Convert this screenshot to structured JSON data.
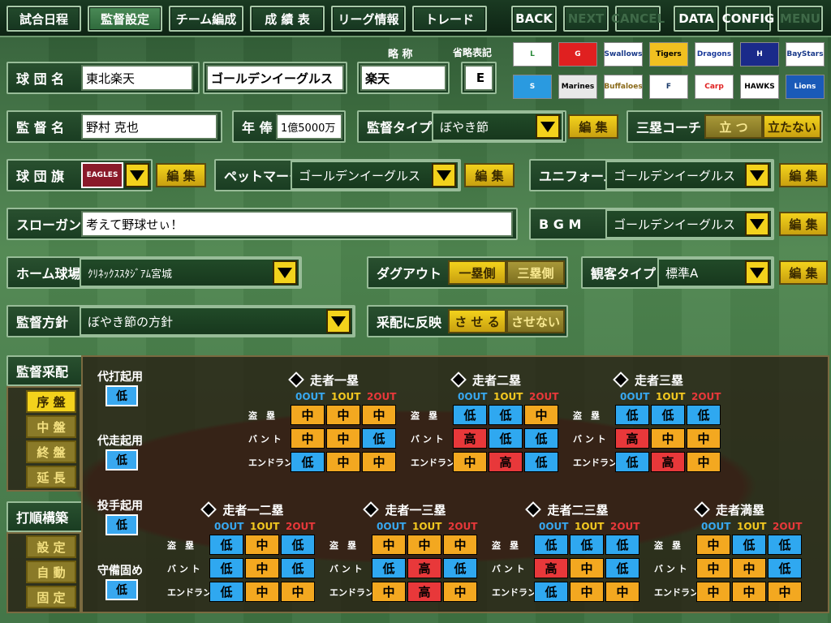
{
  "nav": {
    "items": [
      {
        "label": "試合日程",
        "selected": false
      },
      {
        "label": "監督設定",
        "selected": true
      },
      {
        "label": "チーム編成",
        "selected": false
      },
      {
        "label": "成 績 表",
        "selected": false
      },
      {
        "label": "リーグ情報",
        "selected": false
      },
      {
        "label": "トレード",
        "selected": false
      }
    ],
    "back": "BACK",
    "next": "NEXT",
    "cancel": "CANCEL",
    "data": "DATA",
    "config": "CONFIG",
    "menu": "MENU"
  },
  "team": {
    "name_label": "球 団 名",
    "name": "東北楽天",
    "nickname": "ゴールデンイーグルス",
    "abbr_header": "略 称",
    "abbr": "楽天",
    "short_header": "省略表記",
    "short": "E"
  },
  "logos": [
    {
      "text": "L",
      "bg": "#ffffff",
      "fg": "#2a8a3a"
    },
    {
      "text": "G",
      "bg": "#e02020",
      "fg": "#ffffff"
    },
    {
      "text": "Swallows",
      "bg": "#ffffff",
      "fg": "#1a3a8a"
    },
    {
      "text": "Tigers",
      "bg": "#f0c020",
      "fg": "#000000"
    },
    {
      "text": "Dragons",
      "bg": "#ffffff",
      "fg": "#1a3a9a"
    },
    {
      "text": "H",
      "bg": "#1a2a8a",
      "fg": "#ffffff"
    },
    {
      "text": "BayStars",
      "bg": "#ffffff",
      "fg": "#1a3a8a"
    },
    {
      "text": "S",
      "bg": "#2a9ae0",
      "fg": "#ffffff"
    },
    {
      "text": "Marines",
      "bg": "#e8e8e8",
      "fg": "#000000"
    },
    {
      "text": "Buffaloes",
      "bg": "#ffffff",
      "fg": "#8a6a1a"
    },
    {
      "text": "F",
      "bg": "#ffffff",
      "fg": "#1a3a6a"
    },
    {
      "text": "Carp",
      "bg": "#ffffff",
      "fg": "#e02020"
    },
    {
      "text": "HAWKS",
      "bg": "#ffffff",
      "fg": "#000000"
    },
    {
      "text": "Lions",
      "bg": "#1a5ab8",
      "fg": "#ffffff"
    },
    {
      "text": "EAGLES",
      "bg": "#8a1a2a",
      "fg": "#ffffff"
    }
  ],
  "manager": {
    "label": "監 督 名",
    "name": "野村 克也",
    "salary_label": "年 俸",
    "salary": "1億5000万",
    "type_label": "監督タイプ",
    "type": "ぼやき節",
    "edit": "編 集",
    "coach_label": "三塁コーチ",
    "coach_on": "立 つ",
    "coach_off": "立たない"
  },
  "flag": {
    "label": "球 団 旗",
    "flag_text": "EAGLES",
    "edit": "編 集",
    "pet_label": "ペットマーク",
    "pet": "ゴールデンイーグルス",
    "uniform_label": "ユニフォーム",
    "uniform": "ゴールデンイーグルス"
  },
  "slogan": {
    "label": "スローガン",
    "text": "考えて野球せぃ！",
    "bgm_label": "B G M",
    "bgm": "ゴールデンイーグルス"
  },
  "stadium": {
    "label": "ホーム球場",
    "name": "ｸﾘﾈｯｸｽｽﾀｼﾞｱﾑ宮城",
    "dugout_label": "ダグアウト",
    "dugout_1": "一塁側",
    "dugout_3": "三塁側",
    "crowd_label": "観客タイプ",
    "crowd": "標準A"
  },
  "policy": {
    "label": "監督方針",
    "text": "ぼやき節の方針",
    "reflect_label": "采配に反映",
    "reflect_yes": "さ せ る",
    "reflect_no": "させない"
  },
  "tactics": {
    "label": "監督采配",
    "phases": [
      "序 盤",
      "中 盤",
      "終 盤",
      "延 長"
    ],
    "order_label": "打順構築",
    "order_modes": [
      "設 定",
      "自 動",
      "固 定"
    ],
    "subs": [
      {
        "label": "代打起用",
        "value": "低"
      },
      {
        "label": "代走起用",
        "value": "低"
      },
      {
        "label": "投手起用",
        "value": "低"
      },
      {
        "label": "守備固め",
        "value": "低"
      }
    ],
    "out_headers": [
      "0OUT",
      "1OUT",
      "2OUT"
    ],
    "row_labels": [
      "盗　塁",
      "バ ン ト",
      "エンドラン"
    ],
    "runners": [
      {
        "title": "走者一塁",
        "grid": [
          [
            "中",
            "中",
            "中"
          ],
          [
            "中",
            "中",
            "低"
          ],
          [
            "低",
            "中",
            "中"
          ]
        ]
      },
      {
        "title": "走者二塁",
        "grid": [
          [
            "低",
            "低",
            "中"
          ],
          [
            "高",
            "低",
            "低"
          ],
          [
            "中",
            "高",
            "低"
          ]
        ]
      },
      {
        "title": "走者三塁",
        "grid": [
          [
            "低",
            "低",
            "低"
          ],
          [
            "高",
            "中",
            "中"
          ],
          [
            "低",
            "高",
            "中"
          ]
        ]
      },
      {
        "title": "走者一二塁",
        "grid": [
          [
            "低",
            "中",
            "低"
          ],
          [
            "低",
            "中",
            "低"
          ],
          [
            "低",
            "中",
            "中"
          ]
        ]
      },
      {
        "title": "走者一三塁",
        "grid": [
          [
            "中",
            "中",
            "中"
          ],
          [
            "低",
            "高",
            "低"
          ],
          [
            "中",
            "高",
            "中"
          ]
        ]
      },
      {
        "title": "走者二三塁",
        "grid": [
          [
            "低",
            "低",
            "低"
          ],
          [
            "高",
            "中",
            "低"
          ],
          [
            "低",
            "中",
            "中"
          ]
        ]
      },
      {
        "title": "走者満塁",
        "grid": [
          [
            "中",
            "低",
            "低"
          ],
          [
            "中",
            "中",
            "低"
          ],
          [
            "中",
            "中",
            "中"
          ]
        ]
      }
    ]
  }
}
